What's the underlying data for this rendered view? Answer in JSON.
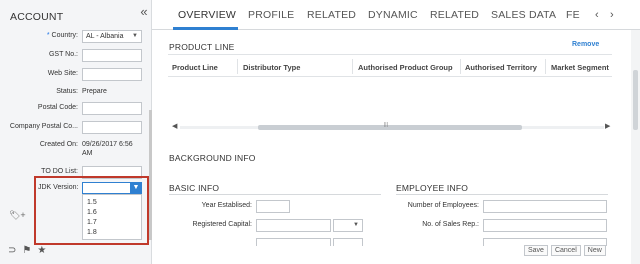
{
  "left_panel": {
    "title": "ACCOUNT",
    "collapse_icon": "«",
    "fields": {
      "country_required": "*",
      "country_label": "Country:",
      "country_value": "AL - Albania",
      "gst_label": "GST No.:",
      "website_label": "Web Site:",
      "status_label": "Status:",
      "status_value": "Prepare",
      "postal_label": "Postal Code:",
      "company_postal_label": "Company Postal Co...",
      "created_label": "Created On:",
      "created_value_line1": "09/26/2017 6:56",
      "created_value_line2": "AM",
      "todo_label": "TO DO List:",
      "jdk_label": "JDK Version:"
    },
    "jdk_options": [
      "1.5",
      "1.6",
      "1.7",
      "1.8"
    ],
    "tags_icon_name": "tags-add-icon",
    "bottom_icons": [
      "rss-icon",
      "flag-icon",
      "star-icon"
    ]
  },
  "tabs": {
    "items": [
      "OVERVIEW",
      "PROFILE",
      "RELATED",
      "DYNAMIC",
      "RELATED",
      "SALES DATA",
      "FE"
    ],
    "active_index": 0,
    "prev": "‹",
    "next": "›"
  },
  "product_line": {
    "title": "PRODUCT LINE",
    "remove_label": "Remove",
    "columns": [
      "Product Line",
      "Distributor Type",
      "Authorised Product Group",
      "Authorised Territory",
      "Market Segment"
    ]
  },
  "background_info": {
    "title": "BACKGROUND INFO"
  },
  "basic_info": {
    "title": "BASIC INFO",
    "year_label": "Year Establised:",
    "capital_label": "Registered Capital:"
  },
  "employee_info": {
    "title": "EMPLOYEE INFO",
    "employees_label": "Number of Employees:",
    "sales_reps_label": "No. of Sales Rep.:"
  },
  "footer": {
    "save": "Save",
    "cancel": "Cancel",
    "new": "New"
  },
  "colors": {
    "accent": "#2f80d1",
    "highlight_border": "#c0392b",
    "panel_bg": "#f4f5f7"
  }
}
